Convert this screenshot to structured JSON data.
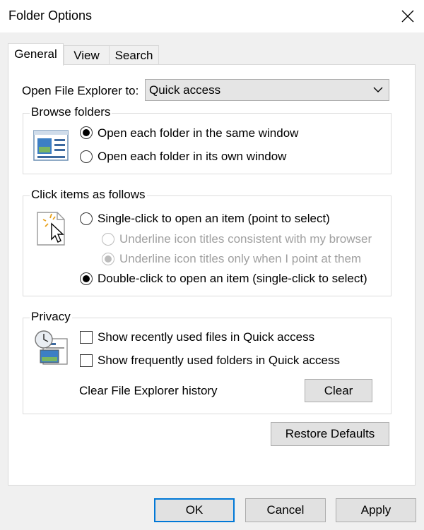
{
  "window": {
    "title": "Folder Options"
  },
  "tabs": [
    {
      "label": "General",
      "active": true
    },
    {
      "label": "View",
      "active": false
    },
    {
      "label": "Search",
      "active": false
    }
  ],
  "open_explorer": {
    "label": "Open File Explorer to:",
    "value": "Quick access"
  },
  "browse_folders": {
    "title": "Browse folders",
    "options": [
      {
        "label": "Open each folder in the same window",
        "checked": true
      },
      {
        "label": "Open each folder in its own window",
        "checked": false
      }
    ]
  },
  "click_items": {
    "title": "Click items as follows",
    "single_click": {
      "label": "Single-click to open an item (point to select)",
      "checked": false
    },
    "underline_browser": {
      "label": "Underline icon titles consistent with my browser",
      "checked": false,
      "disabled": true
    },
    "underline_point": {
      "label": "Underline icon titles only when I point at them",
      "checked": true,
      "disabled": true
    },
    "double_click": {
      "label": "Double-click to open an item (single-click to select)",
      "checked": true
    }
  },
  "privacy": {
    "title": "Privacy",
    "recent_files": {
      "label": "Show recently used files in Quick access",
      "checked": false
    },
    "frequent_folders": {
      "label": "Show frequently used folders in Quick access",
      "checked": false
    },
    "clear_history_label": "Clear File Explorer history",
    "clear_button": "Clear"
  },
  "restore_defaults": "Restore Defaults",
  "footer": {
    "ok": "OK",
    "cancel": "Cancel",
    "apply": "Apply"
  },
  "colors": {
    "accent": "#0078d7",
    "panel": "#ffffff",
    "window": "#f0f0f0"
  }
}
